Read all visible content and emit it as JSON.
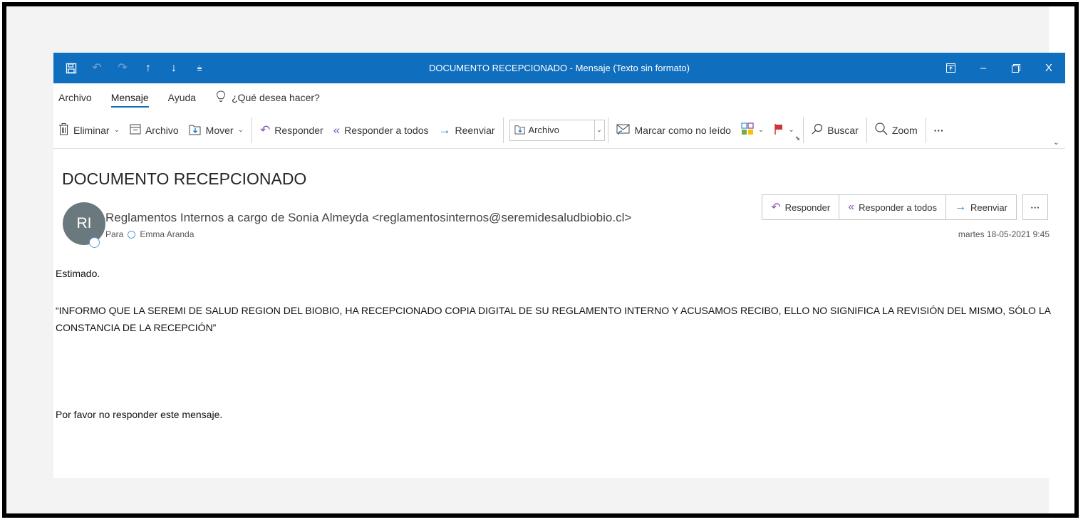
{
  "window": {
    "title": "DOCUMENTO RECEPCIONADO  -  Mensaje (Texto sin formato)"
  },
  "menu": {
    "items": [
      "Archivo",
      "Mensaje",
      "Ayuda"
    ],
    "active": "Mensaje",
    "tell_me": "¿Qué desea hacer?"
  },
  "ribbon": {
    "delete": "Eliminar",
    "archive": "Archivo",
    "move": "Mover",
    "reply": "Responder",
    "reply_all": "Responder a todos",
    "forward": "Reenviar",
    "quick_step": "Archivo",
    "mark_unread": "Marcar como no leído",
    "search": "Buscar",
    "zoom": "Zoom",
    "more": "···"
  },
  "message": {
    "subject": "DOCUMENTO RECEPCIONADO",
    "avatar_initials": "RI",
    "sender": "Reglamentos Internos a cargo de Sonia Almeyda <reglamentosinternos@seremidesaludbiobio.cl>",
    "to_label": "Para",
    "to_name": "Emma Aranda",
    "date": "martes 18-05-2021 9:45",
    "actions": {
      "reply": "Responder",
      "reply_all": "Responder a todos",
      "forward": "Reenviar",
      "more": "···"
    },
    "body": {
      "greeting": "Estimado.",
      "paragraph": "“INFORMO QUE LA SEREMI DE SALUD REGION DEL BIOBIO, HA RECEPCIONADO COPIA DIGITAL DE SU REGLAMENTO INTERNO Y ACUSAMOS RECIBO, ELLO NO SIGNIFICA LA REVISIÓN DEL MISMO, SÓLO LA CONSTANCIA DE LA RECEPCIÓN”",
      "footer": "Por favor no responder este mensaje."
    }
  },
  "colors": {
    "titlebar": "#106ebe",
    "reply_icon": "#8a57b4",
    "forward_icon": "#106ebe",
    "avatar": "#69797e"
  }
}
